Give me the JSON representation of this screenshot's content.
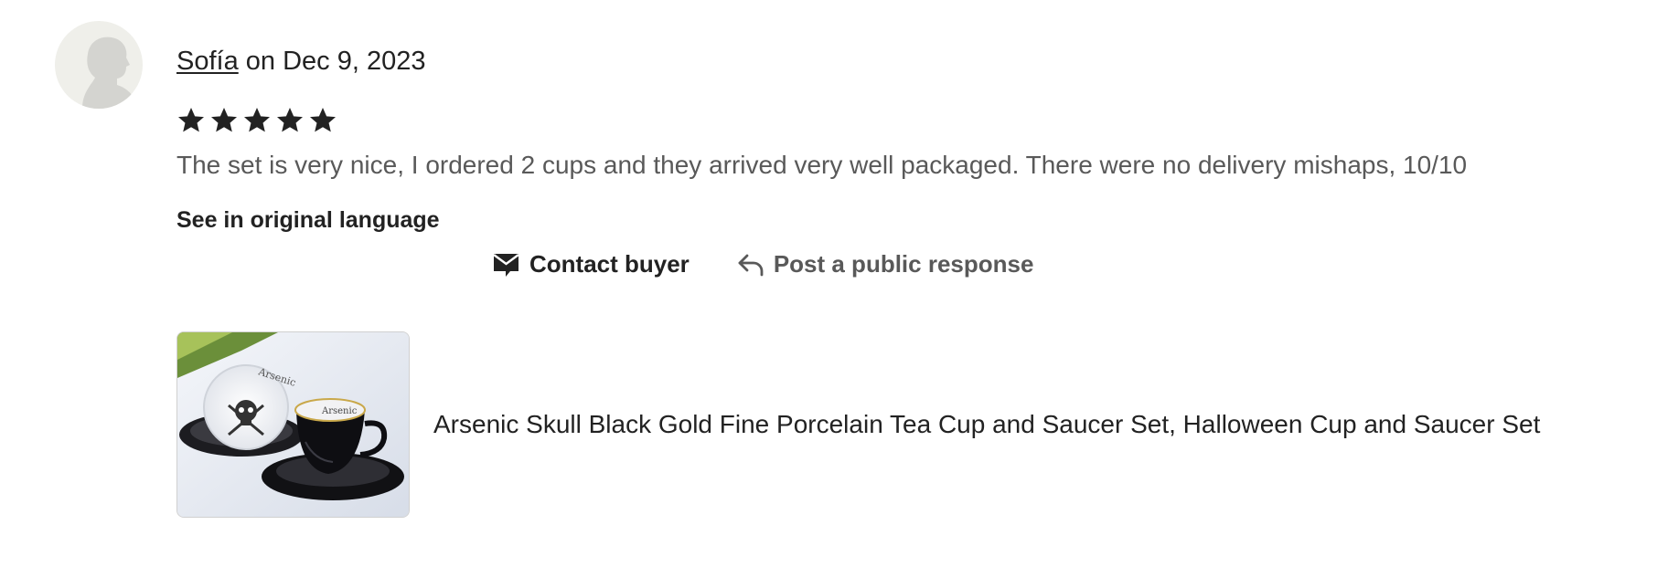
{
  "review": {
    "reviewer_name": "Sofía",
    "date_text": " on Dec 9, 2023",
    "rating": 5,
    "rating_max": 5,
    "text": "The set is very nice, I ordered 2 cups and they arrived very well packaged. There were no delivery mishaps, 10/10",
    "see_original_label": "See in original language"
  },
  "actions": {
    "contact_label": "Contact buyer",
    "contact_icon": "envelope-icon",
    "respond_label": "Post a public response",
    "respond_icon": "reply-arrow-icon"
  },
  "listing": {
    "title": "Arsenic Skull Black Gold Fine Porcelain Tea Cup and Saucer Set, Halloween Cup and Saucer Set",
    "cup_inscription": "Arsenic"
  },
  "colors": {
    "star": "#222222",
    "muted_text": "#595959",
    "avatar_bg": "#efefea",
    "avatar_silhouette": "#d4d4d0"
  }
}
